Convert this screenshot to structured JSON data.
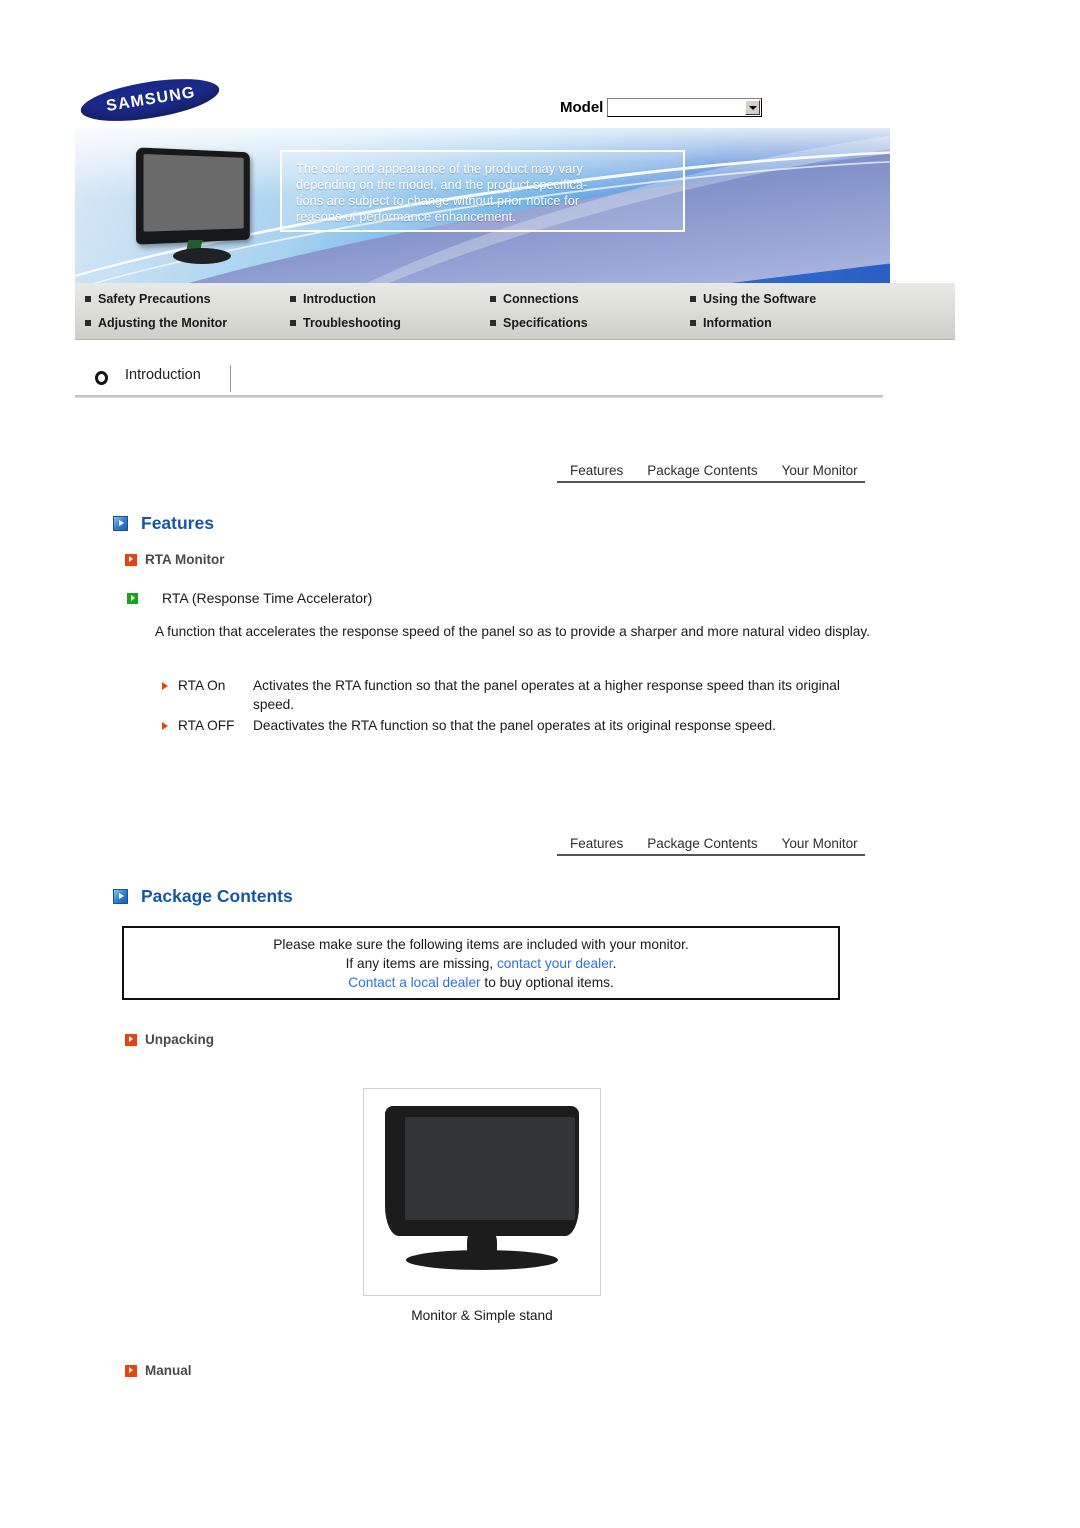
{
  "header": {
    "brand": "SAMSUNG",
    "model_label": "Model",
    "model_value": "",
    "model_placeholder": ""
  },
  "banner": {
    "notice_lines": [
      "The color and appearance of the product may vary",
      "depending on the model, and the product specifica-",
      "tions are subject to change without prior notice for",
      "reasons of performance enhancement."
    ]
  },
  "main_nav": {
    "items": [
      "Safety Precautions",
      "Introduction",
      "Connections",
      "Using the Software",
      "Adjusting the Monitor",
      "Troubleshooting",
      "Specifications",
      "Information"
    ]
  },
  "breadcrumb": {
    "label": "Introduction"
  },
  "sub_tabs": {
    "items": [
      "Features",
      "Package Contents",
      "Your Monitor"
    ]
  },
  "features": {
    "heading": "Features",
    "sub_heading": "RTA Monitor",
    "green_item": "RTA (Response Time Accelerator)",
    "paragraph": "A function that accelerates the response speed of the panel so as to provide a sharper and more natural video display.",
    "rows": [
      {
        "term": "RTA On",
        "desc": "Activates the RTA function so that the panel operates at a higher response speed than its original speed."
      },
      {
        "term": "RTA OFF",
        "desc": "Deactivates the RTA function so that the panel operates at its original response speed."
      }
    ]
  },
  "package_contents": {
    "heading": "Package Contents",
    "notice": {
      "line1": "Please make sure the following items are included with your monitor.",
      "line2_pre": "If any items are missing, ",
      "line2_link": "contact your dealer",
      "line2_post": ".",
      "line3_link": "Contact a local dealer",
      "line3_post": " to buy optional items."
    },
    "unpacking_heading": "Unpacking",
    "item_caption": "Monitor & Simple stand",
    "manual_heading": "Manual"
  },
  "colors": {
    "section_blue": "#1557a5",
    "accent_orange": "#e2450f",
    "accent_green": "#16a61e",
    "link_blue": "#2b72e0",
    "samsung_navy": "#1b2a8a"
  }
}
